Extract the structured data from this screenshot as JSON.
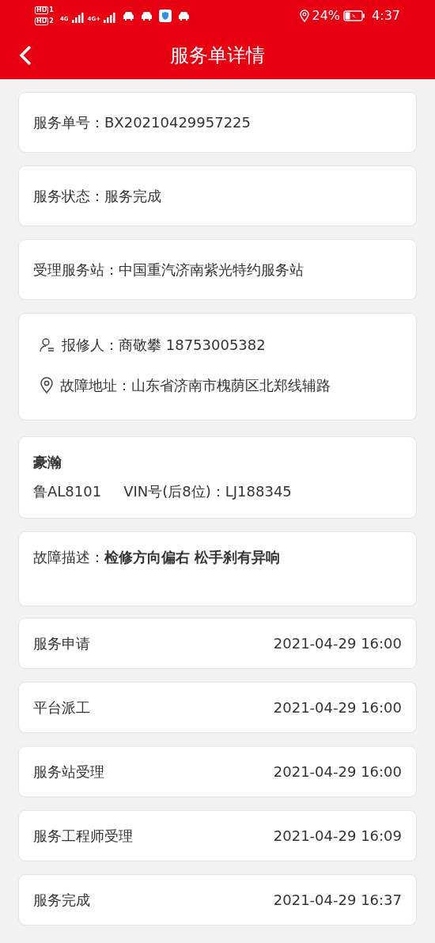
{
  "status_bar": {
    "sims": [
      {
        "label": "HD",
        "index": "1"
      },
      {
        "label": "HD",
        "index": "2"
      }
    ],
    "networks": [
      "4G",
      "4G+"
    ],
    "battery": "24%",
    "time": "4:37"
  },
  "header": {
    "title": "服务单详情"
  },
  "info_cards": [
    {
      "text": "服务单号：BX20210429957225"
    },
    {
      "text": "服务状态：服务完成"
    },
    {
      "text": "受理服务站：中国重汽济南紫光特约服务站"
    }
  ],
  "contact": [
    {
      "kind": "person",
      "text": "报修人：商敬攀 18753005382"
    },
    {
      "kind": "location",
      "text": "故障地址：山东省济南市槐荫区北郑线辅路"
    }
  ],
  "vehicle": {
    "model": "豪瀚",
    "plate": "鲁AL8101",
    "vin": "VIN号(后8位)：LJ188345"
  },
  "fault": {
    "text": "故障描述：**检修方向偏右 松手刹有异响**"
  },
  "timeline": [
    {
      "step": "服务申请",
      "time": "2021-04-29 16:00"
    },
    {
      "step": "平台派工",
      "time": "2021-04-29 16:00"
    },
    {
      "step": "服务站受理",
      "time": "2021-04-29 16:00"
    },
    {
      "step": "服务工程师受理",
      "time": "2021-04-29 16:09"
    },
    {
      "step": "服务完成",
      "time": "2021-04-29 16:37"
    }
  ]
}
